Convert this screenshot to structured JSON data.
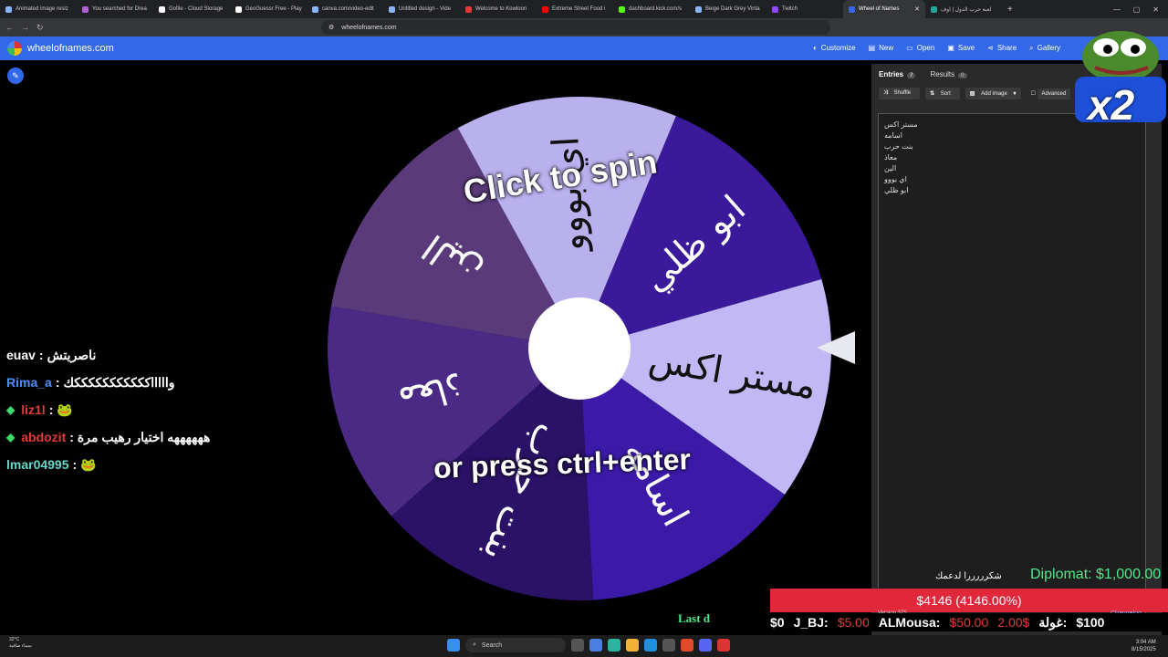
{
  "browser": {
    "tabs": [
      {
        "title": "Animated image resiz",
        "color": "#8ab4f8"
      },
      {
        "title": "You searched for Drea",
        "color": "#b061d6"
      },
      {
        "title": "Gofile - Cloud Storage",
        "color": "#ffffff"
      },
      {
        "title": "GeoGuessr Free - Play",
        "color": "#ffffff"
      },
      {
        "title": "canva.com/video-edit",
        "color": "#8ab4f8"
      },
      {
        "title": "Untitled design - Vide",
        "color": "#8ab4f8"
      },
      {
        "title": "Welcome to Kowloon",
        "color": "#e53935"
      },
      {
        "title": "Extreme Street Food i",
        "color": "#ff0000"
      },
      {
        "title": "dashboard.kick.com/s",
        "color": "#53fc18"
      },
      {
        "title": "Beige Dark Grey Vinta",
        "color": "#8ab4f8"
      },
      {
        "title": "Twitch",
        "color": "#9146ff"
      }
    ],
    "active_tab": "Wheel of Names",
    "last_tab": "لعبة حرب الدول | اوف",
    "url": "wheelofnames.com"
  },
  "app": {
    "site_name": "wheelofnames.com",
    "menu": [
      {
        "icon": "palette-icon",
        "glyph": "◐",
        "label": "Customize"
      },
      {
        "icon": "new-file-icon",
        "glyph": "▤",
        "label": "New"
      },
      {
        "icon": "folder-icon",
        "glyph": "▭",
        "label": "Open"
      },
      {
        "icon": "save-icon",
        "glyph": "▣",
        "label": "Save"
      },
      {
        "icon": "share-icon",
        "glyph": "⋖",
        "label": "Share"
      },
      {
        "icon": "search-icon",
        "glyph": "⌕",
        "label": "Gallery"
      }
    ]
  },
  "wheel": {
    "spin_line1": "Click to spin",
    "spin_line2": "or press ctrl+enter",
    "segments": [
      {
        "label": "مستر اكس",
        "color": "#c1b8f5"
      },
      {
        "label": "اسامه",
        "color": "#3b1aa8"
      },
      {
        "label": "بنت حرب",
        "color": "#2a1266"
      },
      {
        "label": "معاذ",
        "color": "#4a2a85"
      },
      {
        "label": "الين",
        "color": "#5a3a7a"
      },
      {
        "label": "اي بووو",
        "color": "#b9b0ee"
      },
      {
        "label": "ابو ظلي",
        "color": "#3a1a9a"
      }
    ],
    "start_angle_deg": -16
  },
  "chat": [
    {
      "user": "euav",
      "user_color": "#ffffff",
      "msg": "ناصريتش",
      "badge": ""
    },
    {
      "user": "Rima_a",
      "user_color": "#4a90ff",
      "msg": "واااااكككككككككككك",
      "badge": ""
    },
    {
      "user": "liz1l",
      "user_color": "#e03a3a",
      "msg": "🐸",
      "badge": "◆"
    },
    {
      "user": "abdozit",
      "user_color": "#e03a3a",
      "msg": "ههههههه اختيار رهيب مرة",
      "badge": "◆"
    },
    {
      "user": "lmar04995",
      "user_color": "#6ad6c8",
      "msg": "🐸",
      "badge": ""
    }
  ],
  "panel": {
    "tab_entries": "Entries",
    "entries_count": "7",
    "tab_results": "Results",
    "results_count": "0",
    "shuffle": "Shuffle",
    "sort": "Sort",
    "add_image": "Add image",
    "advanced": "Advanced",
    "entries_text": "مستر اكس\nاسامه\nبنت حرب\nمعاذ\nالين\nاي بووو\nابو ظلي"
  },
  "overlay": {
    "multiplier": "x2",
    "thanks": "شكرررررا لدعمك",
    "diplomat": "Diplomat: $1,000.00",
    "bar_text": "$4146 (4146.00%)",
    "ticker": [
      {
        "text": "$0",
        "red": false
      },
      {
        "text": "J_BJ:",
        "red": false
      },
      {
        "text": "$5.00",
        "red": true
      },
      {
        "text": "ALMousa:",
        "red": false
      },
      {
        "text": "$50.00",
        "red": true
      },
      {
        "text": "2.00$",
        "red": true
      },
      {
        "text": "غولة:",
        "red": false
      },
      {
        "text": "$100",
        "red": false
      }
    ],
    "last_label": "Last d",
    "version": "Version 375",
    "changelog": "Changelog"
  },
  "taskbar": {
    "temp": "32°C",
    "weather_desc": "سماء صافية",
    "search": "Search",
    "time": "3:04 AM",
    "date": "8/15/2025"
  }
}
